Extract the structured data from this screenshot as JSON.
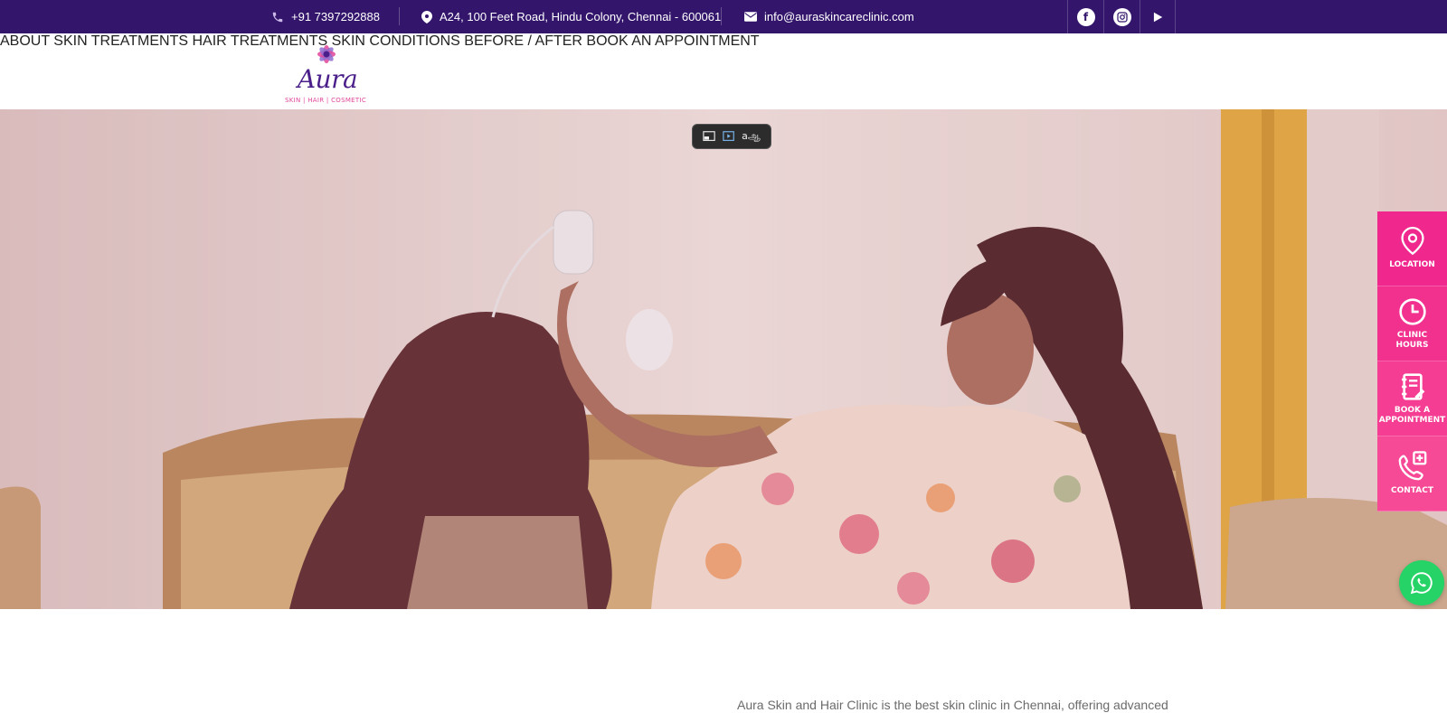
{
  "topbar": {
    "phone": "+91 7397292888",
    "address": "A24, 100 Feet Road, Hindu Colony, Chennai - 600061",
    "email": "info@auraskincareclinic.com",
    "social": [
      "facebook-icon",
      "instagram-icon",
      "youtube-play-icon"
    ]
  },
  "brand": {
    "name": "Aura",
    "tagline": "SKIN | HAIR | COSMETIC"
  },
  "nav": {
    "items": [
      {
        "label": "ABOUT"
      },
      {
        "label": "SKIN TREATMENTS"
      },
      {
        "label": "HAIR TREATMENTS"
      },
      {
        "label": "SKIN CONDITIONS"
      },
      {
        "label": "BEFORE / AFTER"
      },
      {
        "label": "BOOK AN APPOINTMENT"
      }
    ]
  },
  "media_toolbar": {
    "icons": [
      "pip-icon",
      "video-capture-icon",
      "translate-icon"
    ],
    "translate_glyph": "aஆ"
  },
  "sidepanel": {
    "items": [
      {
        "label": "LOCATION",
        "icon": "location-pin-icon"
      },
      {
        "label_line1": "CLINIC",
        "label_line2": "HOURS",
        "icon": "clock-icon"
      },
      {
        "label_line1": "BOOK A",
        "label_line2": "APPOINTMENT",
        "icon": "notebook-icon"
      },
      {
        "label": "CONTACT",
        "icon": "phone-plus-icon"
      }
    ]
  },
  "whatsapp": {
    "icon": "whatsapp-icon"
  },
  "intro": {
    "text": "Aura Skin and Hair Clinic is the best skin clinic in Chennai, offering advanced"
  },
  "colors": {
    "topbar_bg": "#33166b",
    "accent_pink": "#f0278d",
    "whatsapp_green": "#25d366",
    "nav_text": "#2a2a2a"
  }
}
